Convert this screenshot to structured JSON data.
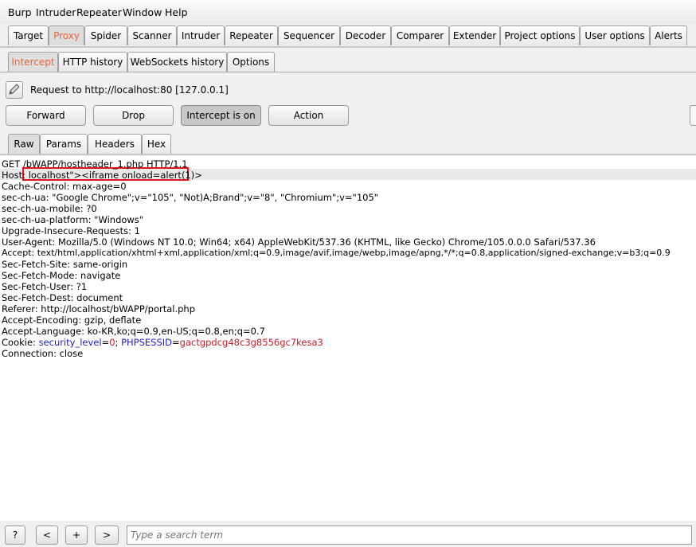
{
  "menu": [
    "Burp",
    "Intruder",
    "Repeater",
    "Window",
    "Help"
  ],
  "main_tabs": [
    "Target",
    "Proxy",
    "Spider",
    "Scanner",
    "Intruder",
    "Repeater",
    "Sequencer",
    "Decoder",
    "Comparer",
    "Extender",
    "Project options",
    "User options",
    "Alerts"
  ],
  "proxy_tabs": [
    "Intercept",
    "HTTP history",
    "WebSockets history",
    "Options"
  ],
  "request_info": "Request to http://localhost:80  [127.0.0.1]",
  "buttons": {
    "forward": "Forward",
    "drop": "Drop",
    "intercept": "Intercept is on",
    "action": "Action"
  },
  "message_tabs": [
    "Raw",
    "Params",
    "Headers",
    "Hex"
  ],
  "request_lines": [
    "GET /bWAPP/hostheader_1.php HTTP/1.1",
    "Host: localhost\"><iframe onload=alert(1)>",
    "Cache-Control: max-age=0",
    "sec-ch-ua: \"Google Chrome\";v=\"105\", \"Not)A;Brand\";v=\"8\", \"Chromium\";v=\"105\"",
    "sec-ch-ua-mobile: ?0",
    "sec-ch-ua-platform: \"Windows\"",
    "Upgrade-Insecure-Requests: 1",
    "User-Agent: Mozilla/5.0 (Windows NT 10.0; Win64; x64) AppleWebKit/537.36 (KHTML, like Gecko) Chrome/105.0.0.0 Safari/537.36",
    "Accept: text/html,application/xhtml+xml,application/xml;q=0.9,image/avif,image/webp,image/apng,*/*;q=0.8,application/signed-exchange;v=b3;q=0.9",
    "Sec-Fetch-Site: same-origin",
    "Sec-Fetch-Mode: navigate",
    "Sec-Fetch-User: ?1",
    "Sec-Fetch-Dest: document",
    "Referer: http://localhost/bWAPP/portal.php",
    "Accept-Encoding: gzip, deflate",
    "Accept-Language: ko-KR,ko;q=0.9,en-US;q=0.8,en;q=0.7"
  ],
  "cookie": {
    "prefix": "Cookie: ",
    "k1": "security_level",
    "eq1": "=",
    "v1": "0",
    "sep": "; ",
    "k2": "PHPSESSID",
    "eq2": "=",
    "v2": "gactgpdcg48c3g8556gc7kesa3"
  },
  "last_line": "Connection: close",
  "search": {
    "help": "?",
    "prev": "<",
    "add": "+",
    "next": ">",
    "placeholder": "Type a search term"
  },
  "colors": {
    "active_tab": "#e8663c",
    "highlight_box": "#e0141e",
    "cookie_key": "#2020c0",
    "cookie_value": "#c0202a"
  }
}
